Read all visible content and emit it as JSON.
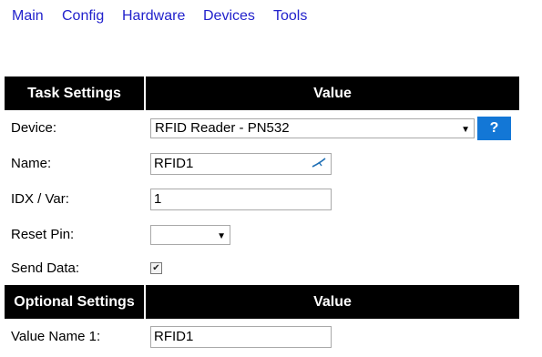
{
  "nav": {
    "items": [
      {
        "label": "Main"
      },
      {
        "label": "Config"
      },
      {
        "label": "Hardware"
      },
      {
        "label": "Devices"
      },
      {
        "label": "Tools"
      }
    ]
  },
  "task_settings": {
    "header_label": "Task Settings",
    "header_value": "Value",
    "device": {
      "label": "Device:",
      "selected": "RFID Reader - PN532"
    },
    "help_button": "?",
    "name": {
      "label": "Name:",
      "value": "RFID1",
      "icon": "edit-pen-icon"
    },
    "idx": {
      "label": "IDX / Var:",
      "value": "1"
    },
    "reset_pin": {
      "label": "Reset Pin:",
      "selected": ""
    },
    "send_data": {
      "label": "Send Data:",
      "checked": true
    }
  },
  "optional_settings": {
    "header_label": "Optional Settings",
    "header_value": "Value",
    "value_name_1": {
      "label": "Value Name 1:",
      "value": "RFID1"
    }
  }
}
